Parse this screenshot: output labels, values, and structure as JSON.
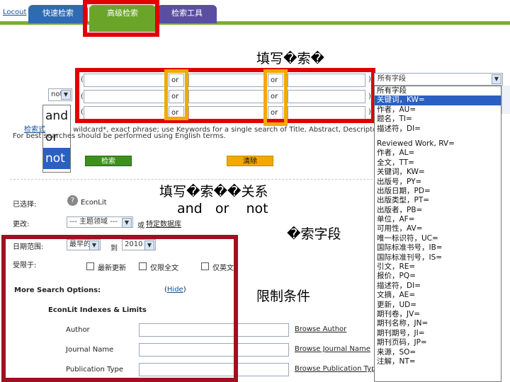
{
  "tabs": {
    "logout": "Locout",
    "quick": "快速检索",
    "advanced": "高级检索",
    "tools": "检索工具"
  },
  "captions": {
    "fill_terms": "填写�索�",
    "fill_relation": "填写�索��关系",
    "bool_words": "and   or    not",
    "field": "�索字段",
    "limit": "限制条件"
  },
  "search_rows": {
    "op": "or",
    "paren_open": "(",
    "paren_close": ")"
  },
  "bool_select": {
    "value": "not",
    "options": [
      "and",
      "or",
      "not"
    ]
  },
  "field_select": {
    "value": "所有字段",
    "options_top": [
      "所有字段",
      "关键词，KW=",
      "作者，AU=",
      "题名，TI=",
      "描述符，DI="
    ],
    "options_rest": [
      "Reviewed Work, RV=",
      "作者，AL=",
      "全文，TT=",
      "关键词，KW=",
      "出版号，PY=",
      "出版日期，PD=",
      "出版类型，PT=",
      "出版者，PB=",
      "单位，AF=",
      "可用性，AV=",
      "唯一标识符，UC=",
      "国际标准书号，IB=",
      "国际标准刊号，IS=",
      "引文，RE=",
      "报价，PQ=",
      "描述符，DI=",
      "文摘，AE=",
      "更新，UD=",
      "期刊卷，JV=",
      "期刊名称，JN=",
      "期刊期号，JI=",
      "期刊页码，JP=",
      "来源，SO=",
      "注解，NT="
    ],
    "selected_index": 1
  },
  "help": {
    "line1_link": "检索式",
    "line1": "wildcard*, exact phrase; use Keywords for a single search of Title, Abstract, Descriptors",
    "line2": "For best    searches should be performed using English terms."
  },
  "buttons": {
    "search": "检索",
    "clear": "清除"
  },
  "filters": {
    "selected_label": "已选择:",
    "selected_db": "EconLit",
    "change_label": "更改:",
    "subject_select": "--- 主题领域 ---",
    "or_text": "或",
    "choose_db": "特定数据库",
    "date_label": "日期范围:",
    "from_value": "最早的",
    "to_text": "到",
    "to_value": "2010",
    "limit_label": "受限于:",
    "check_latest": "最新更新",
    "check_fulltext": "仅限全文",
    "check_english": "仅英文"
  },
  "more_options": {
    "title": "More Search Options:",
    "hide": "Hide",
    "section": "EconLit Indexes & Limits",
    "fields": [
      {
        "label": "Author",
        "browse": "Browse Author"
      },
      {
        "label": "Journal Name",
        "browse": "Browse Journal Name"
      },
      {
        "label": "Publication Type",
        "browse": "Browse Publication Type"
      }
    ]
  },
  "colors": {
    "annotation_red": "#e00000",
    "annotation_orange": "#f2a900",
    "annotation_dark_red": "#a01020",
    "tab_green": "#6aa52a",
    "select_blue": "#2c5fc2"
  }
}
